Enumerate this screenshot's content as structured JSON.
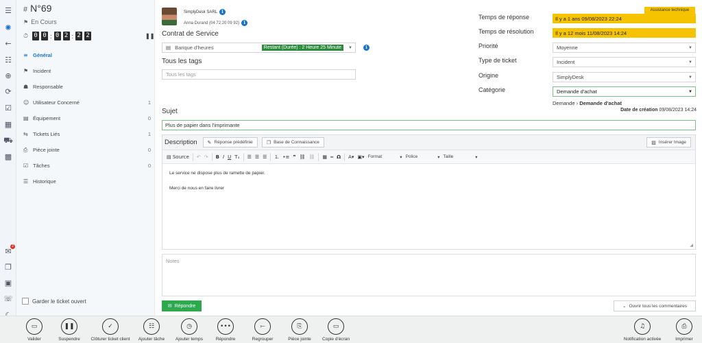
{
  "rail": {
    "icons": [
      "menu-icon",
      "brand-logo-icon",
      "back-arrow-icon",
      "contacts-icon",
      "add-icon",
      "refresh-icon",
      "checklist-icon",
      "qr-icon",
      "cart-icon",
      "grid-icon"
    ],
    "bottom_icons": [
      "chat-notification-icon",
      "book-icon",
      "inbox-icon",
      "comment-icon",
      "moon-icon",
      "user-avatar-icon"
    ],
    "notification_count": "2"
  },
  "sidebar": {
    "ticket_number": "N°69",
    "status": "En Cours",
    "timer": [
      "0",
      "0",
      "0",
      "2",
      "2",
      "2"
    ],
    "nav": [
      {
        "icon": "≡",
        "label": "Général",
        "count": "",
        "active": true
      },
      {
        "icon": "⚑",
        "label": "Incident",
        "count": ""
      },
      {
        "icon": "☗",
        "label": "Responsable",
        "count": ""
      },
      {
        "icon": "☺",
        "label": "Utilisateur Concerné",
        "count": "1"
      },
      {
        "icon": "▤",
        "label": "Équipement",
        "count": "0"
      },
      {
        "icon": "⇆",
        "label": "Tickets Liés",
        "count": "1"
      },
      {
        "icon": "⎙",
        "label": "Pièce jointe",
        "count": "0"
      },
      {
        "icon": "☑",
        "label": "Tâches",
        "count": "0"
      },
      {
        "icon": "☰",
        "label": "Historique",
        "count": ""
      }
    ],
    "keep_open_label": "Garder le ticket ouvert"
  },
  "header": {
    "company": "SimplyDesk SARL",
    "contact": "Anna Durand (04 72 20 09 92)"
  },
  "contract": {
    "label": "Contrat de Service",
    "value": "Banque d'heures",
    "remaining": "Restant (Durée) : 2 Heure 25 Minute"
  },
  "tags": {
    "label": "Tous les tags",
    "placeholder": "Tous les tags"
  },
  "details": {
    "assist_tag": "Assistance technique",
    "response_label": "Temps de réponse",
    "response_value": "Il y a 1 ans 09/08/2023 22:24",
    "resolution_label": "Temps de résolution",
    "resolution_value": "Il y a 12 mois 11/08/2023 14:24",
    "priority_label": "Priorité",
    "priority_value": "Moyenne",
    "type_label": "Type de ticket",
    "type_value": "Incident",
    "origin_label": "Origine",
    "origin_value": "SimplyDesk",
    "category_label": "Catégorie",
    "category_value": "Demande d'achat",
    "breadcrumb_parent": "Demande",
    "breadcrumb_child": "Demande d'achat",
    "created_label": "Date de création",
    "created_value": "09/08/2023 14:24"
  },
  "subject": {
    "label": "Sujet",
    "value": "Plus de papier dans l'imprimante"
  },
  "description": {
    "label": "Description",
    "predef_button": "Réponse prédéfinie",
    "kb_button": "Base de Connaissance",
    "insert_image": "Insérer Image",
    "toolbar": {
      "source": "Source",
      "format": "Format",
      "font": "Police",
      "size": "Taille"
    },
    "lines": [
      "Le service ne dispose plus de ramette de papier.",
      "Merci de nous en faire livrer"
    ]
  },
  "notes": {
    "placeholder": "Notes"
  },
  "reply_button": "Répondre",
  "open_comments": "Ouvrir tous les commentaires",
  "actions": [
    {
      "icon": "💾",
      "label": "Valider"
    },
    {
      "icon": "❚❚",
      "label": "Suspendre"
    },
    {
      "icon": "✓",
      "label": "Clôturer ticket client"
    },
    {
      "icon": "☷",
      "label": "Ajouter tâche"
    },
    {
      "icon": "⏱",
      "label": "Ajouter temps"
    },
    {
      "icon": "•••",
      "label": "Répondre"
    },
    {
      "icon": "⤚",
      "label": "Regrouper"
    },
    {
      "icon": "⎘",
      "label": "Pièce jointe"
    },
    {
      "icon": "▭",
      "label": "Copie d'écran"
    },
    {
      "icon": "🔔",
      "label": "Notification activée"
    },
    {
      "icon": "⎙",
      "label": "Imprimer"
    }
  ],
  "colors": {
    "accent": "#1a73c9",
    "warning": "#f6c300",
    "success": "#2ea84d"
  }
}
